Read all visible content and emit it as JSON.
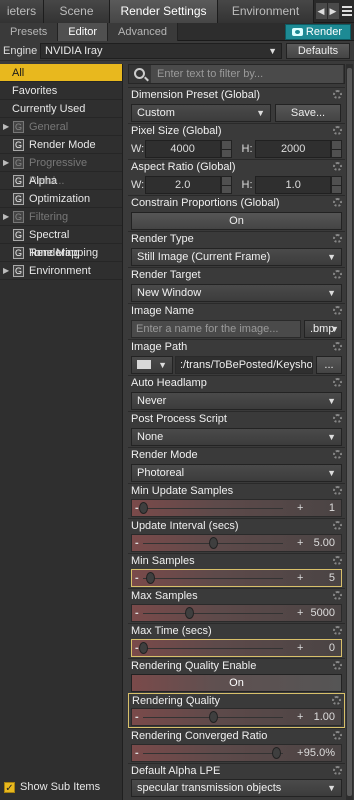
{
  "tabs": {
    "t0": "ieters",
    "t1": "Scene",
    "t2": "Render Settings",
    "t3": "Environment"
  },
  "subtabs": {
    "presets": "Presets",
    "editor": "Editor",
    "advanced": "Advanced",
    "render": "Render"
  },
  "engine": {
    "label": "Engine :",
    "value": "NVIDIA Iray",
    "defaults": "Defaults"
  },
  "left": {
    "items": [
      "All",
      "Favorites",
      "Currently Used"
    ],
    "tree": [
      "General",
      "Render Mode",
      "Progressive Rend...",
      "Alpha",
      "Optimization",
      "Filtering",
      "Spectral Rendering",
      "Tone Mapping",
      "Environment"
    ],
    "g": "G",
    "show_sub": "Show Sub Items"
  },
  "filter_placeholder": "Enter text to filter by...",
  "props": {
    "dimension": {
      "label": "Dimension Preset (Global)",
      "value": "Custom",
      "save": "Save..."
    },
    "pixel": {
      "label": "Pixel Size (Global)",
      "w_key": "W:",
      "w": "4000",
      "h_key": "H:",
      "h": "2000"
    },
    "aspect": {
      "label": "Aspect Ratio (Global)",
      "w_key": "W:",
      "w": "2.0",
      "h_key": "H:",
      "h": "1.0"
    },
    "constrain": {
      "label": "Constrain Proportions (Global)",
      "value": "On"
    },
    "render_type": {
      "label": "Render Type",
      "value": "Still Image (Current Frame)"
    },
    "render_target": {
      "label": "Render Target",
      "value": "New Window"
    },
    "image_name": {
      "label": "Image Name",
      "placeholder": "Enter a name for the image...",
      "ext": ".bmp"
    },
    "image_path": {
      "label": "Image Path",
      "value": ":/trans/ToBePosted/Keyshot",
      "browse": "..."
    },
    "auto_headlamp": {
      "label": "Auto Headlamp",
      "value": "Never"
    },
    "post_process": {
      "label": "Post Process Script",
      "value": "None"
    },
    "render_mode": {
      "label": "Render Mode",
      "value": "Photoreal"
    },
    "min_update": {
      "label": "Min Update Samples",
      "value": "1",
      "level": 0.0
    },
    "update_interval": {
      "label": "Update Interval (secs)",
      "value": "5.00",
      "level": 0.5
    },
    "min_samples": {
      "label": "Min Samples",
      "value": "5",
      "level": 0.05
    },
    "max_samples": {
      "label": "Max Samples",
      "value": "5000",
      "level": 0.33
    },
    "max_time": {
      "label": "Max Time (secs)",
      "value": "0",
      "level": 0.0
    },
    "quality_enable": {
      "label": "Rendering Quality Enable",
      "value": "On"
    },
    "quality": {
      "label": "Rendering Quality",
      "value": "1.00",
      "level": 0.5
    },
    "converged": {
      "label": "Rendering Converged Ratio",
      "value": "95.0%",
      "level": 0.95
    },
    "alpha_lpe": {
      "label": "Default Alpha LPE",
      "value": "specular transmission objects"
    }
  },
  "symbols": {
    "minus": "-",
    "plus": "+",
    "dd": "▼",
    "left": "◀",
    "right": "▶",
    "check": "✓"
  }
}
